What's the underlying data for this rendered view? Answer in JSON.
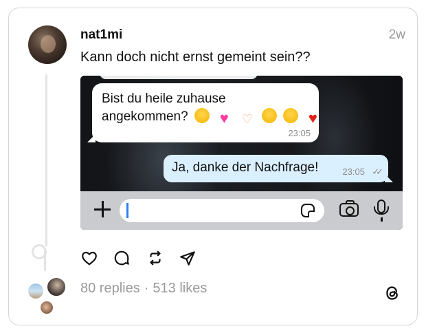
{
  "post": {
    "username": "nat1mi",
    "time": "2w",
    "caption": "Kann doch nicht ernst gemeint sein??",
    "stats": {
      "replies": "80 replies",
      "separator": "·",
      "likes": "513 likes"
    }
  },
  "chat": {
    "incoming": {
      "line1": "Bist du heile zuhause",
      "line2": "angekommen?",
      "emojis": [
        "pleading-face",
        "pink-heart",
        "heart-hands",
        "pleading-face",
        "pleading-face",
        "red-heart"
      ],
      "time": "23:05"
    },
    "outgoing": {
      "text": "Ja, danke der Nachfrage!",
      "time": "23:05",
      "status": "read"
    },
    "input": {
      "placeholder": ""
    }
  },
  "icons": {
    "actions": [
      "heart-icon",
      "comment-icon",
      "repost-icon",
      "share-icon"
    ],
    "brand": "threads-logo"
  },
  "colors": {
    "outgoing_bubble": "#dbf0ff",
    "incoming_bubble": "#ffffff",
    "cursor": "#2f7cf6",
    "muted_text": "#9a9a9a"
  }
}
